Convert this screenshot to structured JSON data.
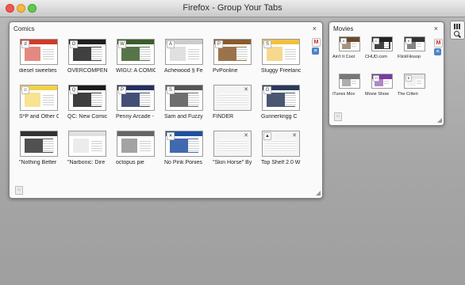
{
  "window": {
    "title": "Firefox - Group Your Tabs"
  },
  "groups": {
    "comics": {
      "title": "Comics",
      "close": "×",
      "tabs": [
        {
          "label": "diesel sweeties",
          "accent": "#d23a2a",
          "dark": false,
          "fav": "d"
        },
        {
          "label": "OVERCOMPENSATING",
          "accent": "#1f1f1f",
          "dark": true,
          "fav": "O"
        },
        {
          "label": "WIGU: A COMIC",
          "accent": "#3b5d2a",
          "dark": true,
          "fav": "W"
        },
        {
          "label": "Achewood § Fe",
          "accent": "#cccccc",
          "dark": false,
          "fav": "A"
        },
        {
          "label": "PvPonline",
          "accent": "#8a5a2b",
          "dark": true,
          "fav": "P"
        },
        {
          "label": "Sluggy Freelance",
          "accent": "#f0c040",
          "dark": false,
          "fav": "S"
        },
        {
          "label": "S*P and Other C",
          "accent": "#f2d04a",
          "dark": false,
          "fav": "☺"
        },
        {
          "label": "QC: New Comic",
          "accent": "#1c1c1c",
          "dark": true,
          "fav": "Q"
        },
        {
          "label": "Penny Arcade -",
          "accent": "#233060",
          "dark": true,
          "fav": "P"
        },
        {
          "label": "Sam and Fuzzy",
          "accent": "#555555",
          "dark": true,
          "fav": "S"
        },
        {
          "label": "FINDER",
          "accent": "#e8e8e8",
          "dark": false,
          "fav": "",
          "placeholder": true
        },
        {
          "label": "Gunnerkrigg C",
          "accent": "#2a3a5a",
          "dark": true,
          "fav": "G"
        },
        {
          "label": "\"Nothing Better",
          "accent": "#333333",
          "dark": true,
          "fav": ""
        },
        {
          "label": "\"Narbonic: Dire",
          "accent": "#e0e0e0",
          "dark": false,
          "fav": ""
        },
        {
          "label": "octopus pie",
          "accent": "#666666",
          "dark": false,
          "fav": ""
        },
        {
          "label": "No Pink Ponies",
          "accent": "#2050a0",
          "dark": true,
          "fav": "✕"
        },
        {
          "label": "\"Skin Horse\" By",
          "accent": "#e8e8e8",
          "dark": false,
          "fav": "",
          "placeholder": true
        },
        {
          "label": "Top Shelf 2.0 W",
          "accent": "#e8e8e8",
          "dark": false,
          "fav": "▲",
          "placeholder": true
        }
      ]
    },
    "movies": {
      "title": "Movies",
      "close": "×",
      "tabs": [
        {
          "label": "Ain't It Cool",
          "accent": "#6b4a2a",
          "dark": false,
          "fav": "A"
        },
        {
          "label": "CHUD.com",
          "accent": "#222222",
          "dark": true,
          "fav": "C"
        },
        {
          "label": "FlickFilosop",
          "accent": "#333333",
          "dark": false,
          "fav": "fl"
        },
        {
          "label": "iTunes Mov",
          "accent": "#777777",
          "dark": false,
          "fav": ""
        },
        {
          "label": "Movie Show",
          "accent": "#7a3aa0",
          "dark": false,
          "fav": "Y!"
        },
        {
          "label": "The Criteri",
          "accent": "#e8e8e8",
          "dark": false,
          "fav": "B"
        }
      ]
    }
  },
  "icons": {
    "gmail": "M",
    "doc": "≡"
  }
}
